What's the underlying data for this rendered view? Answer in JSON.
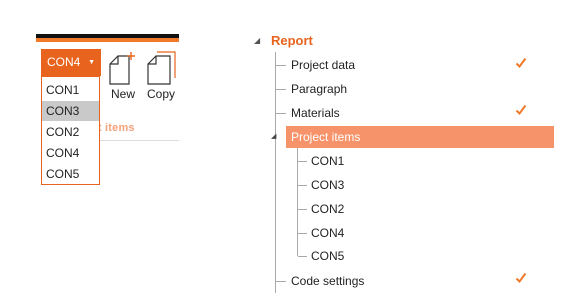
{
  "toolbar": {
    "combo_value": "CON4",
    "dropdown_items": [
      "CON1",
      "CON3",
      "CON2",
      "CON4",
      "CON5"
    ],
    "selected_index": 1,
    "new_label": "New",
    "copy_label": "Copy",
    "group_label": "ject items"
  },
  "tree": {
    "root_label": "Report",
    "items": [
      {
        "label": "Project data",
        "checked": true
      },
      {
        "label": "Paragraph",
        "checked": false
      },
      {
        "label": "Materials",
        "checked": true
      },
      {
        "label": "Project items",
        "checked": false,
        "selected": true
      }
    ],
    "sub_items": [
      "CON1",
      "CON3",
      "CON2",
      "CON4",
      "CON5"
    ],
    "last_item": {
      "label": "Code settings",
      "checked": true
    }
  },
  "colors": {
    "accent": "#e8641e",
    "selection": "#f7936a",
    "check": "#f07a2a"
  }
}
